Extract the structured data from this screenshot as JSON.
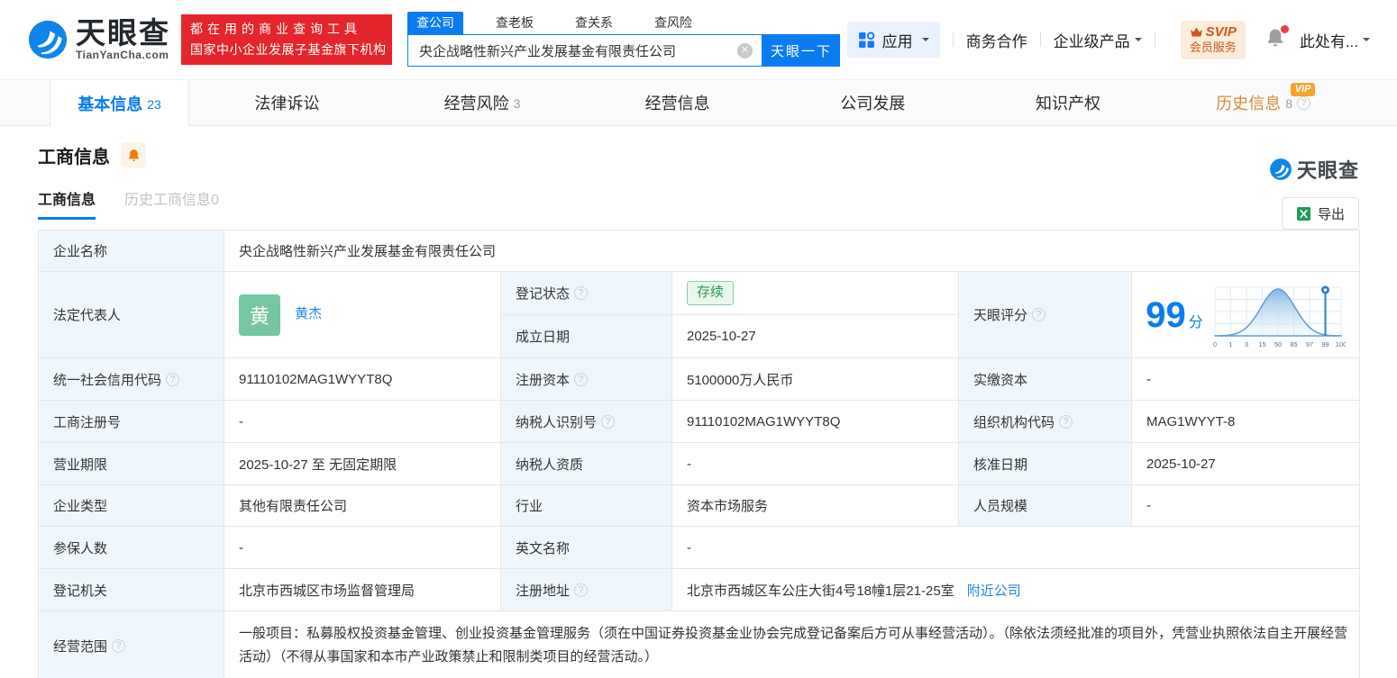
{
  "brand": {
    "logo_text": "天眼查",
    "logo_domain": "TianYanCha.com",
    "promo_line1": "都在用的商业查询工具",
    "promo_line2": "国家中小企业发展子基金旗下机构"
  },
  "search": {
    "tabs": {
      "company": "查公司",
      "boss": "查老板",
      "relation": "查关系",
      "risk": "查风险"
    },
    "value": "央企战略性新兴产业发展基金有限责任公司",
    "button": "天眼一下"
  },
  "header_right": {
    "apps": "应用",
    "business_coop": "商务合作",
    "enterprise_product": "企业级产品",
    "svip_line1": "SVIP",
    "svip_line2": "会员服务",
    "user": "此处有..."
  },
  "nav": {
    "tabs": [
      {
        "label": "基本信息",
        "count": "23"
      },
      {
        "label": "法律诉讼",
        "count": ""
      },
      {
        "label": "经营风险",
        "count": "3"
      },
      {
        "label": "经营信息",
        "count": ""
      },
      {
        "label": "公司发展",
        "count": ""
      },
      {
        "label": "知识产权",
        "count": ""
      },
      {
        "label": "历史信息",
        "count": "8",
        "vip": "VIP"
      }
    ]
  },
  "section": {
    "title": "工商信息",
    "subtab_current": "工商信息",
    "subtab_history": "历史工商信息0",
    "export_label": "导出",
    "watermark": "天眼查"
  },
  "fields": {
    "company_name": {
      "label": "企业名称",
      "value": "央企战略性新兴产业发展基金有限责任公司"
    },
    "legal_rep": {
      "label": "法定代表人",
      "avatar": "黄",
      "name": "黄杰"
    },
    "reg_status": {
      "label": "登记状态",
      "value": "存续"
    },
    "establish_date": {
      "label": "成立日期",
      "value": "2025-10-27"
    },
    "tyc_score": {
      "label": "天眼评分",
      "score": "99",
      "unit": "分"
    },
    "credit_code": {
      "label": "统一社会信用代码",
      "value": "91110102MAG1WYYT8Q"
    },
    "reg_capital": {
      "label": "注册资本",
      "value": "5100000万人民币"
    },
    "paid_capital": {
      "label": "实缴资本",
      "value": "-"
    },
    "reg_number": {
      "label": "工商注册号",
      "value": "-"
    },
    "taxpayer_id": {
      "label": "纳税人识别号",
      "value": "91110102MAG1WYYT8Q"
    },
    "org_code": {
      "label": "组织机构代码",
      "value": "MAG1WYYT-8"
    },
    "business_term": {
      "label": "营业期限",
      "value": "2025-10-27 至 无固定期限"
    },
    "taxpayer_quality": {
      "label": "纳税人资质",
      "value": "-"
    },
    "approval_date": {
      "label": "核准日期",
      "value": "2025-10-27"
    },
    "company_type": {
      "label": "企业类型",
      "value": "其他有限责任公司"
    },
    "industry": {
      "label": "行业",
      "value": "资本市场服务"
    },
    "staff_size": {
      "label": "人员规模",
      "value": "-"
    },
    "insured_count": {
      "label": "参保人数",
      "value": "-"
    },
    "english_name": {
      "label": "英文名称",
      "value": "-"
    },
    "reg_authority": {
      "label": "登记机关",
      "value": "北京市西城区市场监督管理局"
    },
    "reg_address": {
      "label": "注册地址",
      "value": "北京市西城区车公庄大街4号18幢1层21-25室",
      "link": "附近公司"
    },
    "business_scope": {
      "label": "经营范围",
      "value": "一般项目：私募股权投资基金管理、创业投资基金管理服务（须在中国证券投资基金业协会完成登记备案后方可从事经营活动）。（除依法须经批准的项目外，凭营业执照依法自主开展经营活动）（不得从事国家和本市产业政策禁止和限制类项目的经营活动。）"
    }
  },
  "score_chart": {
    "type": "area",
    "curve": "normal-distribution",
    "ticks": [
      "0",
      "1",
      "3",
      "15",
      "50",
      "85",
      "97",
      "99",
      "100"
    ],
    "marker_tick": "99",
    "score_value": 99
  },
  "colors": {
    "brand_blue": "#0b7cf0",
    "promo_red": "#e4252b",
    "history_orange": "#dd8a38",
    "vip_badge": "#f5a42c",
    "status_green": "#259b49",
    "avatar_green": "#76c7a1",
    "label_cell_bg": "#eff7fc",
    "svip_text": "#cf5a1e"
  }
}
